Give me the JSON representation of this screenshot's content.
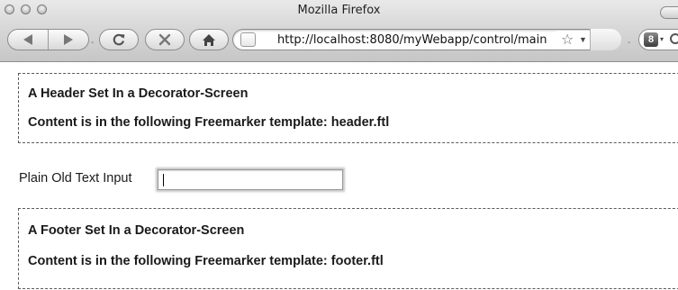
{
  "browser": {
    "window_title": "Mozilla Firefox",
    "url": "http://localhost:8080/myWebapp/control/main",
    "search_engine_letter": "8"
  },
  "page": {
    "header": {
      "line1": "A Header Set In a Decorator-Screen",
      "line2": "Content is in the following Freemarker template: header.ftl"
    },
    "input": {
      "label": "Plain Old Text Input",
      "value": ""
    },
    "footer": {
      "line1": "A Footer Set In a Decorator-Screen",
      "line2": "Content is in the following Freemarker template: footer.ftl"
    }
  }
}
